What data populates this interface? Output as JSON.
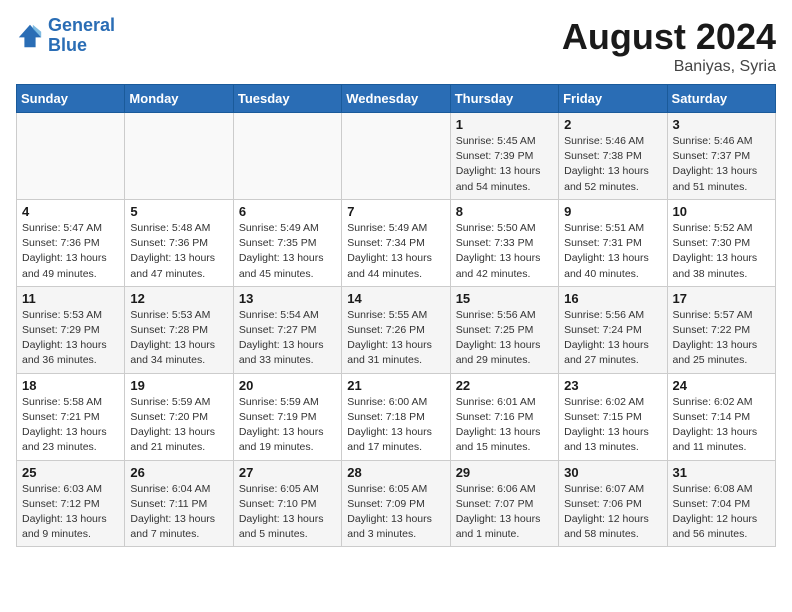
{
  "header": {
    "logo_line1": "General",
    "logo_line2": "Blue",
    "month_year": "August 2024",
    "location": "Baniyas, Syria"
  },
  "days_of_week": [
    "Sunday",
    "Monday",
    "Tuesday",
    "Wednesday",
    "Thursday",
    "Friday",
    "Saturday"
  ],
  "weeks": [
    {
      "days": [
        {
          "num": "",
          "lines": []
        },
        {
          "num": "",
          "lines": []
        },
        {
          "num": "",
          "lines": []
        },
        {
          "num": "",
          "lines": []
        },
        {
          "num": "1",
          "lines": [
            "Sunrise: 5:45 AM",
            "Sunset: 7:39 PM",
            "Daylight: 13 hours",
            "and 54 minutes."
          ]
        },
        {
          "num": "2",
          "lines": [
            "Sunrise: 5:46 AM",
            "Sunset: 7:38 PM",
            "Daylight: 13 hours",
            "and 52 minutes."
          ]
        },
        {
          "num": "3",
          "lines": [
            "Sunrise: 5:46 AM",
            "Sunset: 7:37 PM",
            "Daylight: 13 hours",
            "and 51 minutes."
          ]
        }
      ]
    },
    {
      "days": [
        {
          "num": "4",
          "lines": [
            "Sunrise: 5:47 AM",
            "Sunset: 7:36 PM",
            "Daylight: 13 hours",
            "and 49 minutes."
          ]
        },
        {
          "num": "5",
          "lines": [
            "Sunrise: 5:48 AM",
            "Sunset: 7:36 PM",
            "Daylight: 13 hours",
            "and 47 minutes."
          ]
        },
        {
          "num": "6",
          "lines": [
            "Sunrise: 5:49 AM",
            "Sunset: 7:35 PM",
            "Daylight: 13 hours",
            "and 45 minutes."
          ]
        },
        {
          "num": "7",
          "lines": [
            "Sunrise: 5:49 AM",
            "Sunset: 7:34 PM",
            "Daylight: 13 hours",
            "and 44 minutes."
          ]
        },
        {
          "num": "8",
          "lines": [
            "Sunrise: 5:50 AM",
            "Sunset: 7:33 PM",
            "Daylight: 13 hours",
            "and 42 minutes."
          ]
        },
        {
          "num": "9",
          "lines": [
            "Sunrise: 5:51 AM",
            "Sunset: 7:31 PM",
            "Daylight: 13 hours",
            "and 40 minutes."
          ]
        },
        {
          "num": "10",
          "lines": [
            "Sunrise: 5:52 AM",
            "Sunset: 7:30 PM",
            "Daylight: 13 hours",
            "and 38 minutes."
          ]
        }
      ]
    },
    {
      "days": [
        {
          "num": "11",
          "lines": [
            "Sunrise: 5:53 AM",
            "Sunset: 7:29 PM",
            "Daylight: 13 hours",
            "and 36 minutes."
          ]
        },
        {
          "num": "12",
          "lines": [
            "Sunrise: 5:53 AM",
            "Sunset: 7:28 PM",
            "Daylight: 13 hours",
            "and 34 minutes."
          ]
        },
        {
          "num": "13",
          "lines": [
            "Sunrise: 5:54 AM",
            "Sunset: 7:27 PM",
            "Daylight: 13 hours",
            "and 33 minutes."
          ]
        },
        {
          "num": "14",
          "lines": [
            "Sunrise: 5:55 AM",
            "Sunset: 7:26 PM",
            "Daylight: 13 hours",
            "and 31 minutes."
          ]
        },
        {
          "num": "15",
          "lines": [
            "Sunrise: 5:56 AM",
            "Sunset: 7:25 PM",
            "Daylight: 13 hours",
            "and 29 minutes."
          ]
        },
        {
          "num": "16",
          "lines": [
            "Sunrise: 5:56 AM",
            "Sunset: 7:24 PM",
            "Daylight: 13 hours",
            "and 27 minutes."
          ]
        },
        {
          "num": "17",
          "lines": [
            "Sunrise: 5:57 AM",
            "Sunset: 7:22 PM",
            "Daylight: 13 hours",
            "and 25 minutes."
          ]
        }
      ]
    },
    {
      "days": [
        {
          "num": "18",
          "lines": [
            "Sunrise: 5:58 AM",
            "Sunset: 7:21 PM",
            "Daylight: 13 hours",
            "and 23 minutes."
          ]
        },
        {
          "num": "19",
          "lines": [
            "Sunrise: 5:59 AM",
            "Sunset: 7:20 PM",
            "Daylight: 13 hours",
            "and 21 minutes."
          ]
        },
        {
          "num": "20",
          "lines": [
            "Sunrise: 5:59 AM",
            "Sunset: 7:19 PM",
            "Daylight: 13 hours",
            "and 19 minutes."
          ]
        },
        {
          "num": "21",
          "lines": [
            "Sunrise: 6:00 AM",
            "Sunset: 7:18 PM",
            "Daylight: 13 hours",
            "and 17 minutes."
          ]
        },
        {
          "num": "22",
          "lines": [
            "Sunrise: 6:01 AM",
            "Sunset: 7:16 PM",
            "Daylight: 13 hours",
            "and 15 minutes."
          ]
        },
        {
          "num": "23",
          "lines": [
            "Sunrise: 6:02 AM",
            "Sunset: 7:15 PM",
            "Daylight: 13 hours",
            "and 13 minutes."
          ]
        },
        {
          "num": "24",
          "lines": [
            "Sunrise: 6:02 AM",
            "Sunset: 7:14 PM",
            "Daylight: 13 hours",
            "and 11 minutes."
          ]
        }
      ]
    },
    {
      "days": [
        {
          "num": "25",
          "lines": [
            "Sunrise: 6:03 AM",
            "Sunset: 7:12 PM",
            "Daylight: 13 hours",
            "and 9 minutes."
          ]
        },
        {
          "num": "26",
          "lines": [
            "Sunrise: 6:04 AM",
            "Sunset: 7:11 PM",
            "Daylight: 13 hours",
            "and 7 minutes."
          ]
        },
        {
          "num": "27",
          "lines": [
            "Sunrise: 6:05 AM",
            "Sunset: 7:10 PM",
            "Daylight: 13 hours",
            "and 5 minutes."
          ]
        },
        {
          "num": "28",
          "lines": [
            "Sunrise: 6:05 AM",
            "Sunset: 7:09 PM",
            "Daylight: 13 hours",
            "and 3 minutes."
          ]
        },
        {
          "num": "29",
          "lines": [
            "Sunrise: 6:06 AM",
            "Sunset: 7:07 PM",
            "Daylight: 13 hours",
            "and 1 minute."
          ]
        },
        {
          "num": "30",
          "lines": [
            "Sunrise: 6:07 AM",
            "Sunset: 7:06 PM",
            "Daylight: 12 hours",
            "and 58 minutes."
          ]
        },
        {
          "num": "31",
          "lines": [
            "Sunrise: 6:08 AM",
            "Sunset: 7:04 PM",
            "Daylight: 12 hours",
            "and 56 minutes."
          ]
        }
      ]
    }
  ]
}
